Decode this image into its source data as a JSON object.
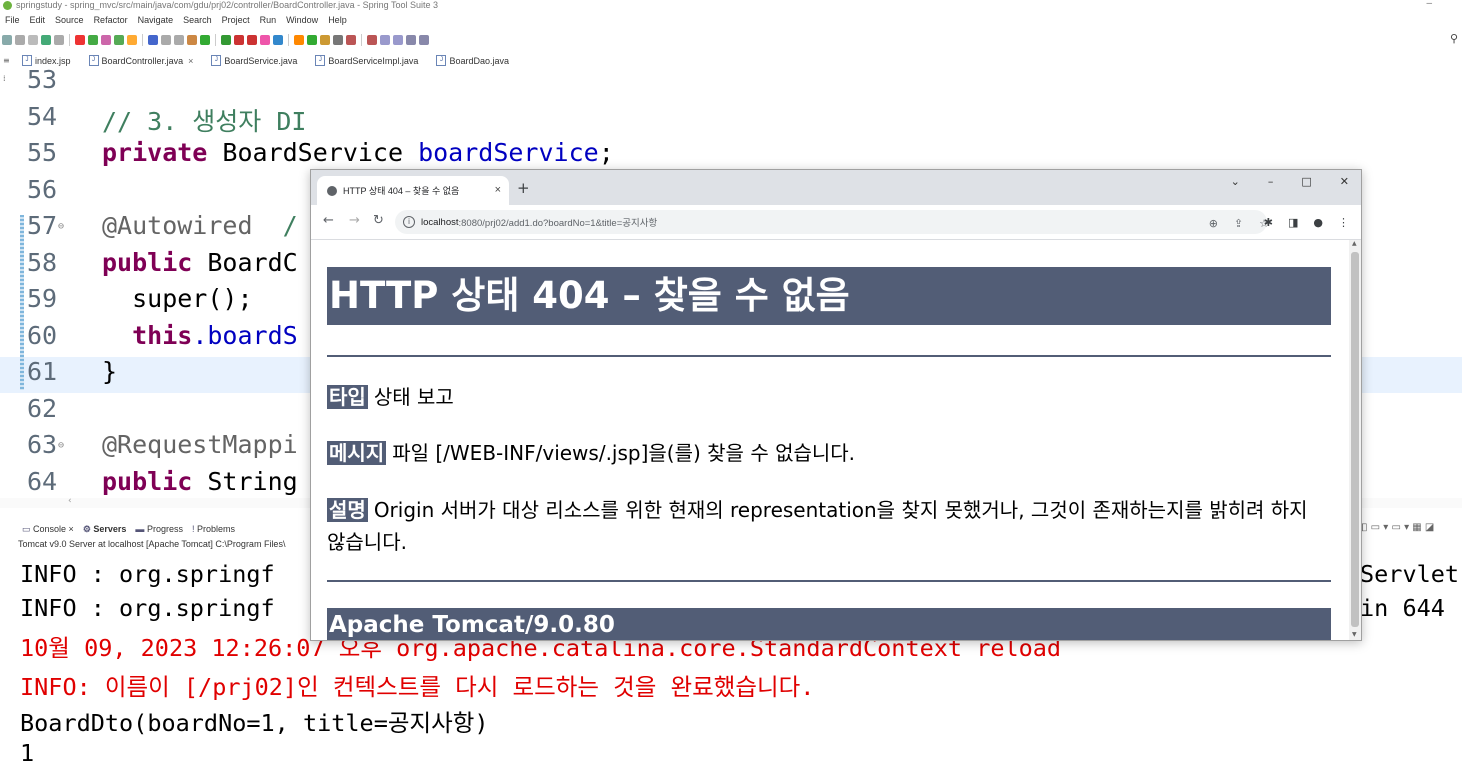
{
  "ide": {
    "title": "springstudy - spring_mvc/src/main/java/com/gdu/prj02/controller/BoardController.java - Spring Tool Suite 3",
    "menu": [
      "File",
      "Edit",
      "Source",
      "Refactor",
      "Navigate",
      "Search",
      "Project",
      "Run",
      "Window",
      "Help"
    ],
    "tabs": [
      {
        "label": "index.jsp",
        "icon": "jsp-file-icon"
      },
      {
        "label": "BoardController.java",
        "icon": "java-file-icon",
        "active": true
      },
      {
        "label": "BoardService.java",
        "icon": "java-file-icon"
      },
      {
        "label": "BoardServiceImpl.java",
        "icon": "java-file-icon"
      },
      {
        "label": "BoardDao.java",
        "icon": "java-file-icon"
      }
    ],
    "editor": {
      "lines": [
        {
          "num": "53",
          "code": ""
        },
        {
          "num": "54",
          "comment": "// 3. 생성자 DI"
        },
        {
          "num": "55",
          "kw": "private",
          "type": " BoardService ",
          "field": "boardService",
          "tail": ";"
        },
        {
          "num": "56",
          "code": ""
        },
        {
          "num": "57",
          "annotation": "@Autowired",
          "comment": "  /"
        },
        {
          "num": "58",
          "kw": "public",
          "tail": " BoardC"
        },
        {
          "num": "59",
          "code": "  super();"
        },
        {
          "num": "60",
          "kw": "  this",
          "field": ".boardS"
        },
        {
          "num": "61",
          "code": "}"
        },
        {
          "num": "62",
          "code": ""
        },
        {
          "num": "63",
          "annotation": "@RequestMappi"
        },
        {
          "num": "64",
          "kw": "public",
          "tail": " String"
        }
      ]
    },
    "console": {
      "tabs": [
        "Console",
        "Servers",
        "Progress",
        "Problems"
      ],
      "status": "Tomcat v9.0 Server at localhost [Apache Tomcat] C:\\Program Files\\",
      "line1_left": "INFO : org.springf",
      "line1_right": "Servlet",
      "line2_left": "INFO : org.springf",
      "line2_right": "in 644",
      "line3": "10월 09, 2023 12:26:07 오후 org.apache.catalina.core.StandardContext reload",
      "line4": "INFO: 이름이 [/prj02]인 컨텍스트를 다시 로드하는 것을 완료했습니다.",
      "line5": "BoardDto(boardNo=1, title=공지사항)",
      "line6": "1"
    }
  },
  "browser": {
    "tab_title": "HTTP 상태 404 – 찾을 수 없음",
    "url_host": "localhost",
    "url_path": ":8080/prj02/add1.do?boardNo=1&title=공지사항",
    "page": {
      "heading": "HTTP 상태 404 – 찾을 수 없음",
      "type_label": "타입",
      "type_value": "상태 보고",
      "message_label": "메시지",
      "message_value": "파일 [/WEB-INF/views/.jsp]을(를) 찾을 수 없습니다.",
      "desc_label": "설명",
      "desc_value": "Origin 서버가 대상 리소스를 위한 현재의 representation을 찾지 못했거나, 그것이 존재하는지를 밝히려 하지 않습니다.",
      "footer": "Apache Tomcat/9.0.80"
    }
  },
  "colors": {
    "tomcat_header": "#525d76",
    "keyword": "#7f0055",
    "comment": "#3f7f5f",
    "field": "#0000c0",
    "console_red": "#e00000"
  }
}
